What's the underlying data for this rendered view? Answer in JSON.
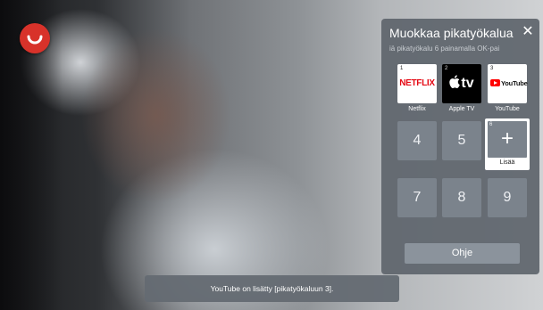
{
  "panel": {
    "title": "Muokkaa pikatyökalua",
    "subtitle": "iä pikatyökalu 6 painamalla OK-pai",
    "close_icon": "close-icon"
  },
  "shortcuts": [
    {
      "index": "1",
      "label": "Netflix",
      "logo_text": "NETFLIX"
    },
    {
      "index": "2",
      "label": "Apple TV",
      "logo_text": "tv"
    },
    {
      "index": "3",
      "label": "YouTube",
      "logo_text": "YouTube"
    }
  ],
  "number_slots": [
    "4",
    "5",
    "7",
    "8",
    "9"
  ],
  "add_slot": {
    "index": "6",
    "label": "Lisää",
    "icon": "plus-icon"
  },
  "help_button": {
    "label": "Ohje"
  },
  "toast": {
    "message": "YouTube on lisätty [pikatyökaluun 3]."
  },
  "colors": {
    "panel_bg": "#5f656d",
    "tile_bg": "#7b838c",
    "netflix_red": "#e50914",
    "youtube_red": "#ff0000",
    "logo_red": "#d8322a"
  }
}
